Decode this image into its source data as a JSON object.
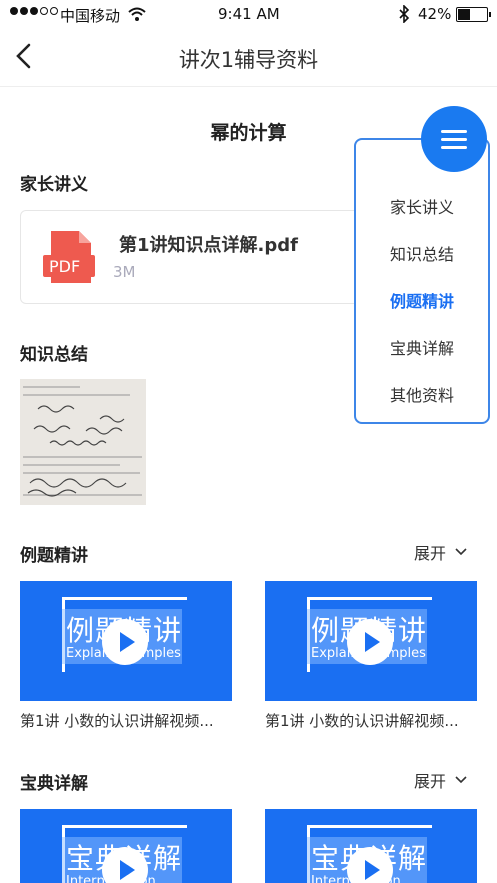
{
  "status": {
    "carrier": "中国移动",
    "time": "9:41 AM",
    "battery": "42%"
  },
  "nav": {
    "title": "讲次1辅导资料"
  },
  "page": {
    "heading": "幂的计算"
  },
  "sections": {
    "handout": {
      "title": "家长讲义"
    },
    "summary": {
      "title": "知识总结"
    },
    "examples": {
      "title": "例题精讲",
      "expand": "展开"
    },
    "treasury": {
      "title": "宝典详解",
      "expand": "展开"
    }
  },
  "pdf": {
    "name": "第1讲知识点详解.pdf",
    "size": "3M",
    "badge": "PDF"
  },
  "example_videos": [
    {
      "thumb_title": "例题精讲",
      "thumb_sub": "Explain Examples",
      "caption": "第1讲  小数的认识讲解视频..."
    },
    {
      "thumb_title": "例题精讲",
      "thumb_sub": "Explain Examples",
      "caption": "第1讲  小数的认识讲解视频..."
    }
  ],
  "treasury_videos": [
    {
      "thumb_title": "宝典详解",
      "thumb_sub": "Interpretation"
    },
    {
      "thumb_title": "宝典详解",
      "thumb_sub": "Interpretation"
    }
  ],
  "menu": {
    "items": [
      {
        "label": "家长讲义",
        "active": false
      },
      {
        "label": "知识总结",
        "active": false
      },
      {
        "label": "例题精讲",
        "active": true
      },
      {
        "label": "宝典详解",
        "active": false
      },
      {
        "label": "其他资料",
        "active": false
      }
    ]
  },
  "colors": {
    "accent": "#1a7af0",
    "pdf_red": "#ee5a4f"
  }
}
